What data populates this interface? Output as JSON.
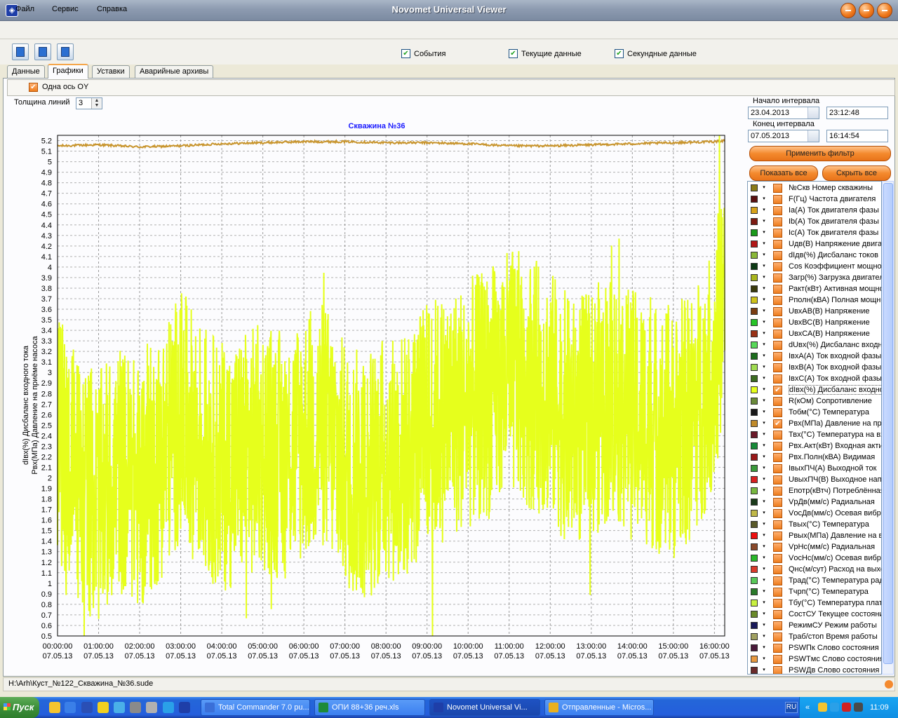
{
  "window": {
    "title": "Novomet Universal Viewer"
  },
  "menu": [
    "Файл",
    "Сервис",
    "Справка"
  ],
  "toolbar": {
    "checks": [
      {
        "label": "События",
        "checked": true
      },
      {
        "label": "Текущие данные",
        "checked": true
      },
      {
        "label": "Секундные данные",
        "checked": true
      }
    ]
  },
  "tabs": [
    "Данные",
    "Графики",
    "Уставки",
    "Аварийные архивы"
  ],
  "active_tab": "Графики",
  "one_axis": {
    "label": "Одна ось OY",
    "checked": true
  },
  "line_thickness": {
    "label": "Толщина линий",
    "value": "3"
  },
  "interval": {
    "start_label": "Начало интервала",
    "start_date": "23.04.2013",
    "start_time": "23:12:48",
    "end_label": "Конец интервала",
    "end_date": "07.05.2013",
    "end_time": "16:14:54"
  },
  "buttons": {
    "apply_filter": "Применить фильтр",
    "show_all": "Показать все",
    "hide_all": "Скрыть все"
  },
  "series_list": [
    {
      "name": "№Скв Номер скважины",
      "color": "#8a7b18",
      "checked": false
    },
    {
      "name": "F(Гц) Частота двигателя",
      "color": "#5a1010",
      "checked": false
    },
    {
      "name": "Ia(A) Ток двигателя фазы A",
      "color": "#d7a21a",
      "checked": false
    },
    {
      "name": "Ib(A) Ток двигателя фазы B",
      "color": "#7c1a12",
      "checked": false
    },
    {
      "name": "Ic(A) Ток двигателя фазы C",
      "color": "#1a9a1a",
      "checked": false
    },
    {
      "name": "Uдв(B) Напряжение двигателя",
      "color": "#b21818",
      "checked": false
    },
    {
      "name": "dIдв(%) Дисбаланс токов",
      "color": "#8ab838",
      "checked": false
    },
    {
      "name": "Cos Коэффициент мощности",
      "color": "#0d3a14",
      "checked": false
    },
    {
      "name": "Загр(%) Загрузка двигателя",
      "color": "#a9b51c",
      "checked": false
    },
    {
      "name": "Ракт(кВт) Активная мощность",
      "color": "#3a3a0c",
      "checked": false
    },
    {
      "name": "Рполн(кВА) Полная мощность",
      "color": "#cfc21a",
      "checked": false
    },
    {
      "name": "UвхАВ(B) Напряжение",
      "color": "#7a3d12",
      "checked": false
    },
    {
      "name": "UвхВС(B) Напряжение",
      "color": "#28c428",
      "checked": false
    },
    {
      "name": "UвхСА(B) Напряжение",
      "color": "#9a3216",
      "checked": false
    },
    {
      "name": "dUвх(%) Дисбаланс входного",
      "color": "#58d858",
      "checked": false
    },
    {
      "name": "IвхА(A) Ток входной фазы A",
      "color": "#1d6d1d",
      "checked": false
    },
    {
      "name": "IвхВ(A) Ток входной фазы B",
      "color": "#a0dc50",
      "checked": false
    },
    {
      "name": "IвхС(A) Ток входной фазы C",
      "color": "#3c6c20",
      "checked": false
    },
    {
      "name": "dIвх(%) Дисбаланс входного тока",
      "color": "#e6ff1c",
      "checked": true
    },
    {
      "name": "R(кОм) Сопротивление",
      "color": "#6a8a3a",
      "checked": false
    },
    {
      "name": "Тобм(°C) Температура",
      "color": "#1a1a1a",
      "checked": false
    },
    {
      "name": "Рвх(МПа) Давление на приёме насоса",
      "color": "#c08a2a",
      "checked": true
    },
    {
      "name": "Твх(°C) Температура на входе",
      "color": "#6b1a2a",
      "checked": false
    },
    {
      "name": "Рвх.Акт(кВт) Входная активная",
      "color": "#188a38",
      "checked": false
    },
    {
      "name": "Рвх.Полн(кВА) Видимая",
      "color": "#9a1818",
      "checked": false
    },
    {
      "name": "IвыхПЧ(A) Выходной ток",
      "color": "#3a9a3a",
      "checked": false
    },
    {
      "name": "UвыхПЧ(B) Выходное напряжение",
      "color": "#d82020",
      "checked": false
    },
    {
      "name": "Епотр(кВтч) Потреблённая",
      "color": "#78b840",
      "checked": false
    },
    {
      "name": "VрДв(мм/с) Радиальная",
      "color": "#1a3a1a",
      "checked": false
    },
    {
      "name": "VосДв(мм/с) Осевая вибрация",
      "color": "#c0b848",
      "checked": false
    },
    {
      "name": "Твых(°C) Температура",
      "color": "#5a5a2a",
      "checked": false
    },
    {
      "name": "Рвых(МПа) Давление на выходе",
      "color": "#ee1010",
      "checked": false
    },
    {
      "name": "VрНс(мм/с) Радиальная",
      "color": "#8a4a2a",
      "checked": false
    },
    {
      "name": "VосНс(мм/с) Осевая вибрация",
      "color": "#2ab82a",
      "checked": false
    },
    {
      "name": "Qнс(м/сут) Расход на выходе",
      "color": "#d83a2a",
      "checked": false
    },
    {
      "name": "Трад(°C) Температура радиатора",
      "color": "#58c858",
      "checked": false
    },
    {
      "name": "Тчрп(°C) Температура",
      "color": "#2a7a2a",
      "checked": false
    },
    {
      "name": "Тбу(°C) Температура платы",
      "color": "#c8f040",
      "checked": false
    },
    {
      "name": "СостСУ Текущее состояние",
      "color": "#6a8a2a",
      "checked": false
    },
    {
      "name": "РежимСУ Режим работы",
      "color": "#1a1a5a",
      "checked": false
    },
    {
      "name": "Траб/стоп Время работы",
      "color": "#a0a060",
      "checked": false
    },
    {
      "name": "PSWПк Слово состояния",
      "color": "#4a1a3a",
      "checked": false
    },
    {
      "name": "PSWTмс Слово состояния",
      "color": "#e89a40",
      "checked": false
    },
    {
      "name": "PSWДв Слово состояния",
      "color": "#6a2a2a",
      "checked": false
    }
  ],
  "chart_data": {
    "type": "line",
    "title": "Скважина №36",
    "ylabel_lines": [
      "dIвх(%) Дисбаланс входного тока",
      "Рвх(МПа) Давление на приёме насоса"
    ],
    "xlabel": "",
    "ylim": [
      0.5,
      5.25
    ],
    "yticks": [
      0.5,
      0.6,
      0.7,
      0.8,
      0.9,
      1,
      1.1,
      1.2,
      1.3,
      1.4,
      1.5,
      1.6,
      1.7,
      1.8,
      1.9,
      2,
      2.1,
      2.2,
      2.3,
      2.4,
      2.5,
      2.6,
      2.7,
      2.8,
      2.9,
      3,
      3.1,
      3.2,
      3.3,
      3.4,
      3.5,
      3.6,
      3.7,
      3.8,
      3.9,
      4,
      4.1,
      4.2,
      4.3,
      4.4,
      4.5,
      4.6,
      4.7,
      4.8,
      4.9,
      5,
      5.1,
      5.2
    ],
    "xlim_hours": [
      0,
      16.25
    ],
    "xticks": [
      {
        "hour": 0,
        "time": "00:00:00",
        "date": "07.05.13"
      },
      {
        "hour": 1,
        "time": "01:00:00",
        "date": "07.05.13"
      },
      {
        "hour": 2,
        "time": "02:00:00",
        "date": "07.05.13"
      },
      {
        "hour": 3,
        "time": "03:00:00",
        "date": "07.05.13"
      },
      {
        "hour": 4,
        "time": "04:00:00",
        "date": "07.05.13"
      },
      {
        "hour": 5,
        "time": "05:00:00",
        "date": "07.05.13"
      },
      {
        "hour": 6,
        "time": "06:00:00",
        "date": "07.05.13"
      },
      {
        "hour": 7,
        "time": "07:00:00",
        "date": "07.05.13"
      },
      {
        "hour": 8,
        "time": "08:00:00",
        "date": "07.05.13"
      },
      {
        "hour": 9,
        "time": "09:00:00",
        "date": "07.05.13"
      },
      {
        "hour": 10,
        "time": "10:00:00",
        "date": "07.05.13"
      },
      {
        "hour": 11,
        "time": "11:00:00",
        "date": "07.05.13"
      },
      {
        "hour": 12,
        "time": "12:00:00",
        "date": "07.05.13"
      },
      {
        "hour": 13,
        "time": "13:00:00",
        "date": "07.05.13"
      },
      {
        "hour": 14,
        "time": "14:00:00",
        "date": "07.05.13"
      },
      {
        "hour": 15,
        "time": "15:00:00",
        "date": "07.05.13"
      },
      {
        "hour": 16,
        "time": "16:00:00",
        "date": "07.05.13"
      }
    ],
    "grid": true,
    "series": [
      {
        "name": "Рвх(МПа) Давление на приёме насоса",
        "color": "#c8952e",
        "x_hours": [
          0,
          1,
          2,
          3,
          4,
          5,
          6,
          7,
          8,
          9,
          10,
          11,
          12,
          13,
          14,
          15,
          16,
          16.25
        ],
        "y": [
          5.15,
          5.16,
          5.14,
          5.15,
          5.17,
          5.18,
          5.19,
          5.19,
          5.18,
          5.18,
          5.17,
          5.15,
          5.15,
          5.16,
          5.17,
          5.18,
          5.19,
          5.2
        ]
      },
      {
        "name": "dIвх(%) Дисбаланс входного тока",
        "color": "#e6ff1c",
        "x_hours": [
          0,
          0.5,
          1,
          1.5,
          2,
          2.5,
          3,
          3.5,
          4,
          4.5,
          5,
          5.5,
          6,
          6.5,
          7,
          7.5,
          8,
          8.5,
          9,
          9.5,
          10,
          10.5,
          11,
          11.5,
          12,
          12.5,
          13,
          13.5,
          14,
          14.5,
          15,
          15.5,
          16,
          16.25
        ],
        "y": [
          2.4,
          2.0,
          1.8,
          2.1,
          1.9,
          2.2,
          2.6,
          2.3,
          2.1,
          2.2,
          2.3,
          2.2,
          2.4,
          2.5,
          2.1,
          2.0,
          2.2,
          2.2,
          2.5,
          2.6,
          2.7,
          2.8,
          3.0,
          2.9,
          2.8,
          2.5,
          2.6,
          2.8,
          2.6,
          2.5,
          2.4,
          2.6,
          3.1,
          3.8
        ]
      }
    ]
  },
  "status": {
    "path": "H:\\Arh\\Куст_№122_Скважина_№36.sude"
  },
  "taskbar": {
    "start": "Пуск",
    "items": [
      {
        "label": "Total Commander 7.0 pu...",
        "active": false,
        "icon": "#3a6fd8"
      },
      {
        "label": "ОПИ 88+36 реч.xls",
        "active": false,
        "icon": "#1d8a3a"
      },
      {
        "label": "Novomet Universal Vi...",
        "active": true,
        "icon": "#1e3ea8"
      },
      {
        "label": "Отправленные - Micros...",
        "active": false,
        "icon": "#e8b020"
      }
    ],
    "lang": "RU",
    "time": "11:09"
  }
}
